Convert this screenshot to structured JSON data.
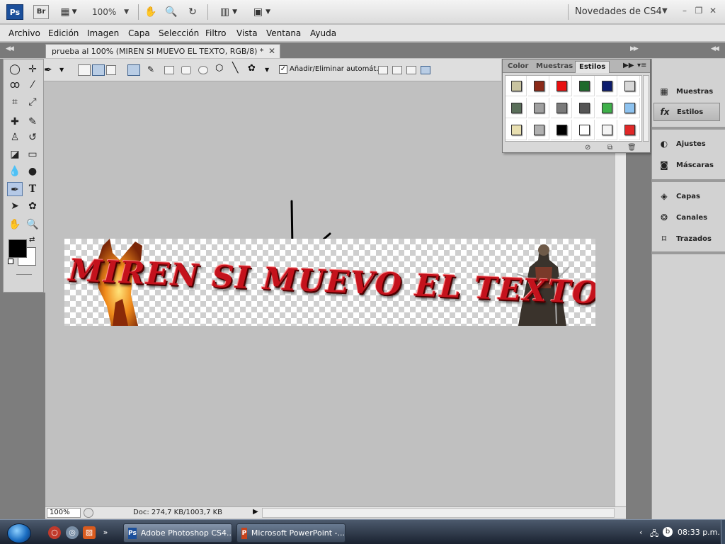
{
  "appbar": {
    "ps_logo": "Ps",
    "br_logo": "Br",
    "zoom": "100%",
    "workspace": "Novedades de CS4"
  },
  "menu": [
    "Archivo",
    "Edición",
    "Imagen",
    "Capa",
    "Selección",
    "Filtro",
    "Vista",
    "Ventana",
    "Ayuda"
  ],
  "document": {
    "tab_title": "prueba al 100% (MIREN SI MUEVO EL TEXTO, RGB/8) *",
    "banner_text": "MIREN SI MUEVO EL TEXTO"
  },
  "options": {
    "auto_add_label": "Añadir/Eliminar automát.",
    "auto_add_checked": true
  },
  "style_panel": {
    "tabs": [
      "Color",
      "Muestras",
      "Estilos"
    ],
    "active_tab": "Estilos",
    "swatches": [
      "#c9c4a0",
      "#8b2a18",
      "#e81010",
      "#1e6a2c",
      "#0c1c6e",
      "#d8d8d8",
      "#5a6f5a",
      "#a0a0a0",
      "#7a7a7a",
      "#555555",
      "#3fb04a",
      "#8ec3f0",
      "#e8dfb0",
      "#b0b0b0",
      "#000000",
      "#ffffff",
      "#f4f4f4",
      "#e02828"
    ]
  },
  "dock": {
    "items": [
      {
        "label": "Muestras",
        "icon": "grid-icon"
      },
      {
        "label": "Estilos",
        "icon": "fx-icon"
      },
      {
        "label": "Ajustes",
        "icon": "adjust-icon"
      },
      {
        "label": "Máscaras",
        "icon": "mask-icon"
      },
      {
        "label": "Capas",
        "icon": "layers-icon"
      },
      {
        "label": "Canales",
        "icon": "channels-icon"
      },
      {
        "label": "Trazados",
        "icon": "paths-icon"
      }
    ]
  },
  "status": {
    "zoom": "100%",
    "doc": "Doc: 274,7 KB/1003,7 KB"
  },
  "taskbar": {
    "tasks": [
      "Adobe Photoshop CS4...",
      "Microsoft PowerPoint -..."
    ],
    "time": "08:33 p.m."
  }
}
